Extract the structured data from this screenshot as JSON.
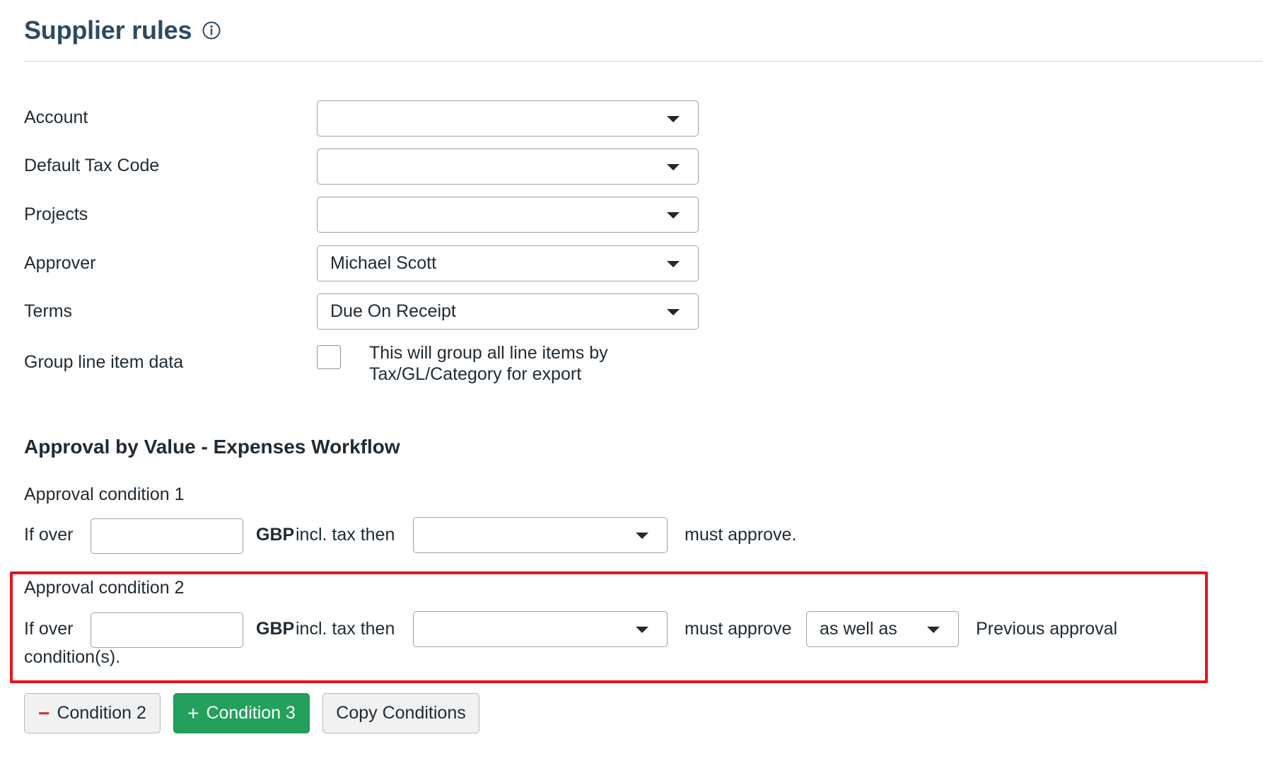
{
  "header": {
    "title": "Supplier rules",
    "info_icon": "info-circle-icon"
  },
  "form": {
    "account": {
      "label": "Account",
      "value": ""
    },
    "default_tax_code": {
      "label": "Default Tax Code",
      "value": ""
    },
    "projects": {
      "label": "Projects",
      "value": ""
    },
    "approver": {
      "label": "Approver",
      "value": "Michael Scott"
    },
    "terms": {
      "label": "Terms",
      "value": "Due On Receipt"
    },
    "group_line_item": {
      "label": "Group line item data",
      "checked": false,
      "description": "This will group all line items by Tax/GL/Category for export"
    }
  },
  "workflow": {
    "title": "Approval by Value - Expenses Workflow",
    "conditions": [
      {
        "label": "Approval condition 1",
        "if_over": "If over",
        "amount": "",
        "currency": "GBP",
        "incl_tax": "incl. tax then",
        "approver": "",
        "must_approve": "must approve."
      },
      {
        "label": "Approval condition 2",
        "if_over": "If over",
        "amount": "",
        "currency": "GBP",
        "incl_tax": "incl. tax then",
        "approver": "",
        "must_approve": "must approve",
        "relation": "as well as",
        "previous_text": "Previous approval",
        "trailing_text": "condition(s)."
      }
    ]
  },
  "buttons": {
    "remove_condition": "Condition 2",
    "add_condition": "Condition 3",
    "copy_conditions": "Copy Conditions",
    "remove_symbol": "−",
    "add_symbol": "+"
  },
  "colors": {
    "title": "#2c4a63",
    "highlight": "#e8121c",
    "add_button": "#23a05c",
    "remove_symbol": "#d32f2f"
  }
}
